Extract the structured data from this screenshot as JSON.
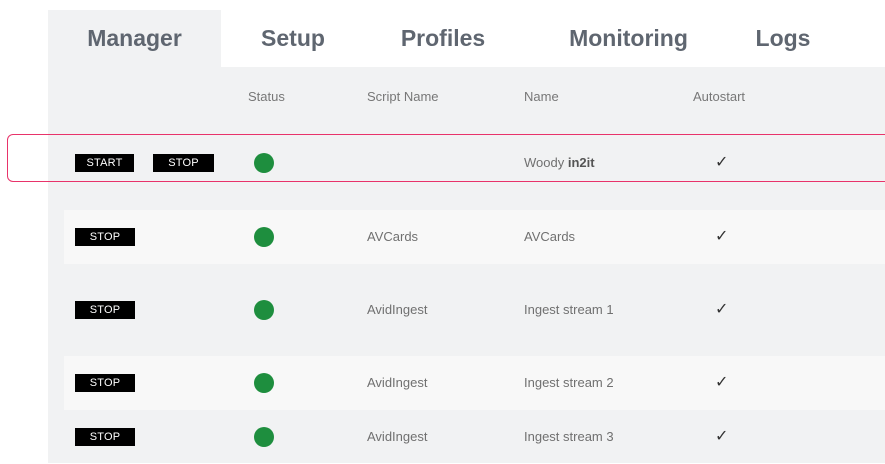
{
  "tabs": [
    {
      "label": "Manager",
      "active": true
    },
    {
      "label": "Setup",
      "active": false
    },
    {
      "label": "Profiles",
      "active": false
    },
    {
      "label": "Monitoring",
      "active": false
    },
    {
      "label": "Logs",
      "active": false
    }
  ],
  "table": {
    "headers": {
      "status": "Status",
      "script_name": "Script Name",
      "name": "Name",
      "autostart": "Autostart"
    },
    "rows": [
      {
        "start_label": "START",
        "stop_label": "STOP",
        "status_color": "#1e8e3e",
        "script_name": "",
        "name_plain": "Woody",
        "name_bold": "in2it",
        "autostart": "✓",
        "highlighted": true
      },
      {
        "stop_label": "STOP",
        "status_color": "#1e8e3e",
        "script_name": "AVCards",
        "name": "AVCards",
        "autostart": "✓"
      },
      {
        "stop_label": "STOP",
        "status_color": "#1e8e3e",
        "script_name": "AvidIngest",
        "name": "Ingest stream 1",
        "autostart": "✓"
      },
      {
        "stop_label": "STOP",
        "status_color": "#1e8e3e",
        "script_name": "AvidIngest",
        "name": "Ingest stream 2",
        "autostart": "✓"
      },
      {
        "stop_label": "STOP",
        "status_color": "#1e8e3e",
        "script_name": "AvidIngest",
        "name": "Ingest stream 3",
        "autostart": "✓"
      }
    ]
  },
  "colors": {
    "status_running": "#1e8e3e",
    "highlight_border": "#e8336a",
    "button_bg": "#000000"
  }
}
